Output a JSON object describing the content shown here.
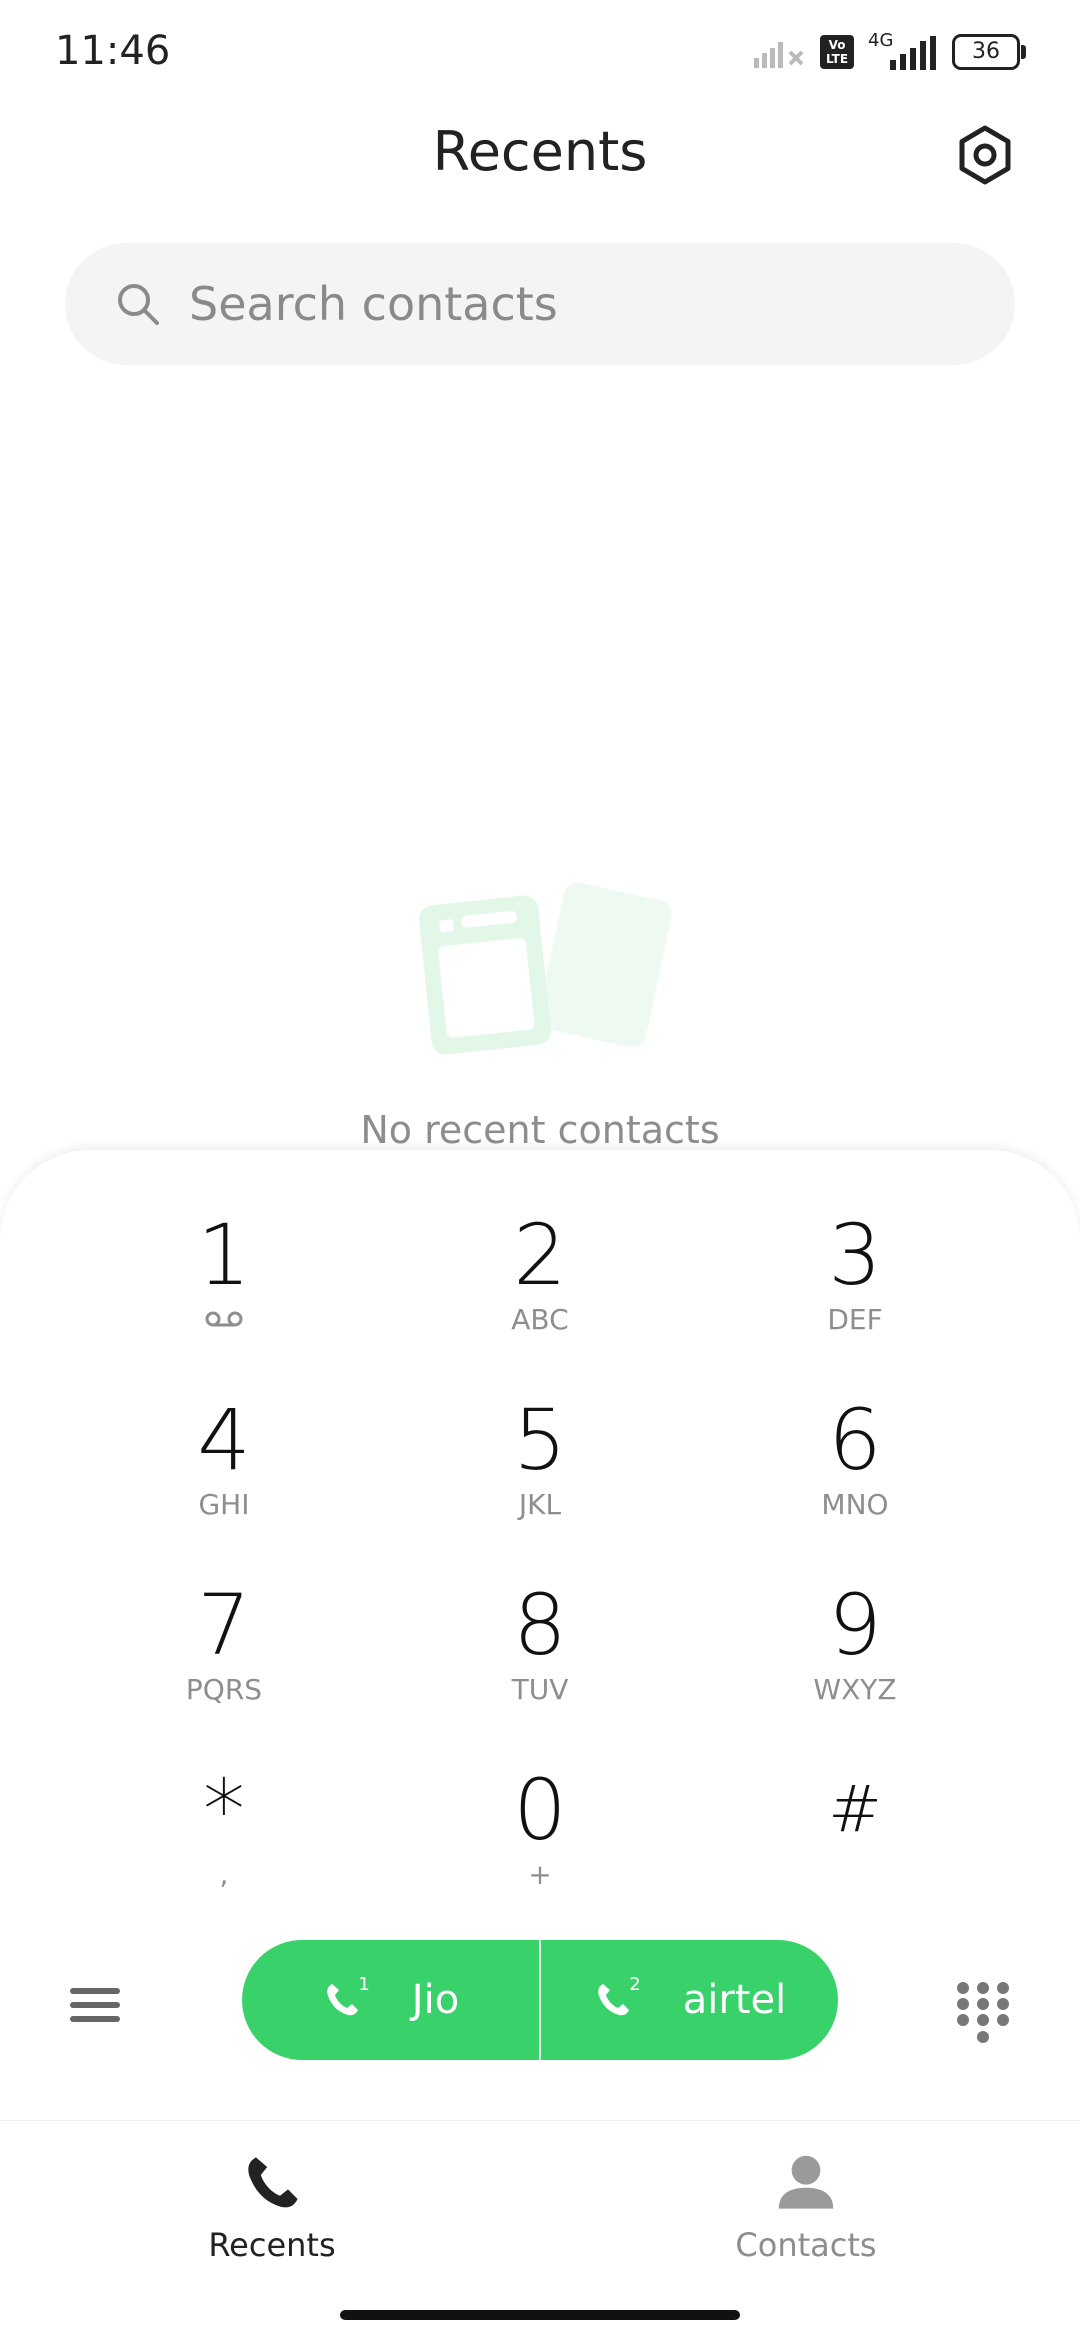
{
  "status_bar": {
    "time": "11:46",
    "network_label": "4G",
    "volte_label": "Vo\nLTE",
    "battery": "36"
  },
  "header": {
    "title": "Recents"
  },
  "search": {
    "placeholder": "Search contacts"
  },
  "empty_state": {
    "text": "No recent contacts"
  },
  "dialpad": {
    "keys": [
      {
        "digit": "1",
        "letters": ""
      },
      {
        "digit": "2",
        "letters": "ABC"
      },
      {
        "digit": "3",
        "letters": "DEF"
      },
      {
        "digit": "4",
        "letters": "GHI"
      },
      {
        "digit": "5",
        "letters": "JKL"
      },
      {
        "digit": "6",
        "letters": "MNO"
      },
      {
        "digit": "7",
        "letters": "PQRS"
      },
      {
        "digit": "8",
        "letters": "TUV"
      },
      {
        "digit": "9",
        "letters": "WXYZ"
      },
      {
        "digit": "*",
        "letters": ","
      },
      {
        "digit": "0",
        "letters": "+"
      },
      {
        "digit": "#",
        "letters": ""
      }
    ]
  },
  "call_buttons": {
    "sim1": {
      "index": "1",
      "label": "Jio"
    },
    "sim2": {
      "index": "2",
      "label": "airtel"
    }
  },
  "bottom_nav": {
    "recents": "Recents",
    "contacts": "Contacts"
  },
  "colors": {
    "accent": "#39d26a",
    "search_bg": "#f4f4f4",
    "muted_text": "#8d8d8d"
  },
  "icons": [
    "settings-icon",
    "search-icon",
    "voicemail-icon",
    "menu-icon",
    "phone-sim-icon",
    "keypad-icon",
    "phone-icon",
    "person-icon"
  ]
}
